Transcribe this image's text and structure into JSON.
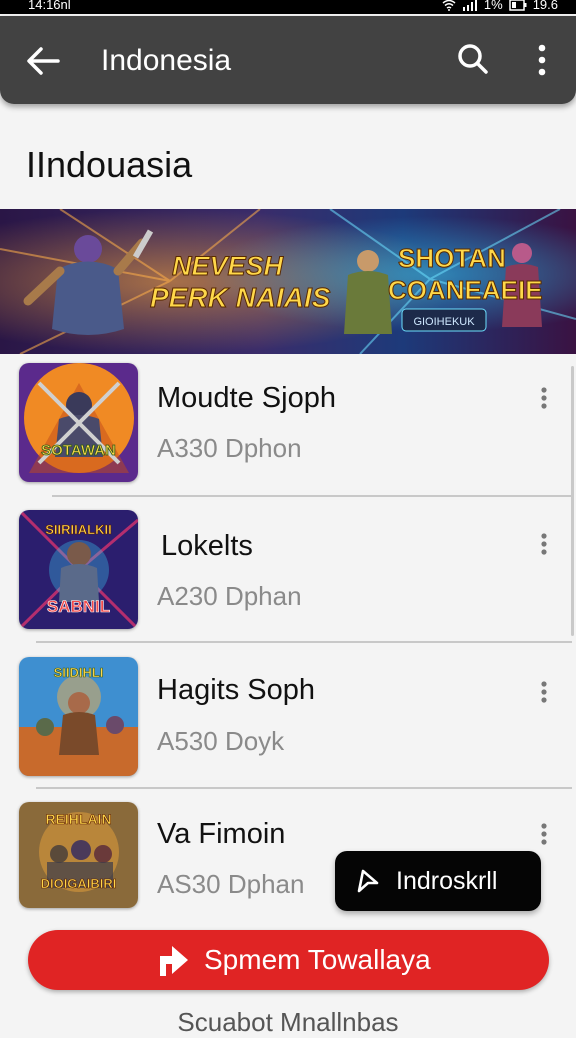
{
  "status_bar": {
    "time": "14:16nl",
    "battery": "1%",
    "clock_right": "19.6"
  },
  "app_bar": {
    "title": "Indonesia",
    "back_icon": "arrow-left-icon",
    "search_icon": "search-icon",
    "more_icon": "more-vert-icon"
  },
  "page": {
    "heading": "IIndouasia"
  },
  "banner": {
    "left_text_line1": "NEVESH",
    "left_text_line2": "PERK NAIAIS",
    "right_title_line1": "SHOTAN",
    "right_title_line2": "COANEAEIE",
    "right_badge": "GIOIHEKUK"
  },
  "list": {
    "items": [
      {
        "title": "Moudte Sjoph",
        "subtitle": "A330 Dphon",
        "thumb_text": "SOTAWAN",
        "thumb_palette": [
          "#f08a24",
          "#5b2a8c"
        ]
      },
      {
        "title": "Lokelts",
        "subtitle": "A230 Dphan",
        "thumb_text_top": "SIIRIIALKII",
        "thumb_text": "SABNIL",
        "thumb_palette": [
          "#2b1e6e",
          "#d8336e"
        ]
      },
      {
        "title": "Hagits Soph",
        "subtitle": "A530 Doyk",
        "thumb_text": "SIIDIHLI",
        "thumb_palette": [
          "#3e8fd0",
          "#c86a2c"
        ]
      },
      {
        "title": "Va Fimoin",
        "subtitle": "AS30 Dphan",
        "thumb_text_top": "REIHLAIN",
        "thumb_text": "DIOIGAIBIRI",
        "thumb_palette": [
          "#8a6a3a",
          "#d89a3a"
        ]
      }
    ]
  },
  "floating_pill": {
    "label": "Indroskrll",
    "icon": "cursor-icon"
  },
  "cta": {
    "label": "Spmem Towallaya",
    "icon": "share-arrow-icon"
  },
  "footer": {
    "text": "Scuabot Mnallnbas"
  },
  "colors": {
    "app_bar": "#424242",
    "cta": "#e02424",
    "pill": "#050505"
  }
}
